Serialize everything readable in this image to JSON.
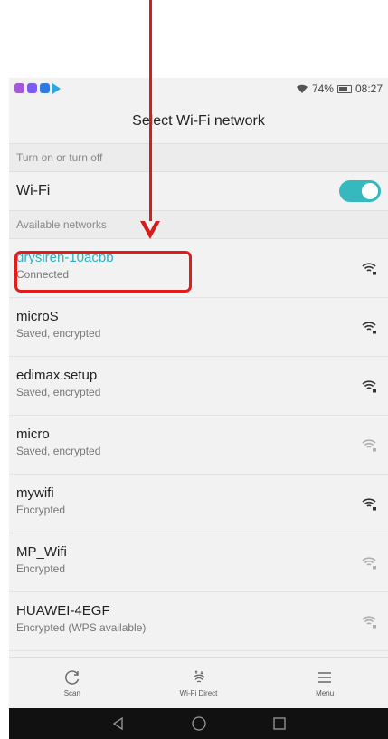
{
  "status_bar": {
    "battery": "74%",
    "time": "08:27",
    "notification_icons": [
      "app-icon-purple",
      "app-icon-violet",
      "app-icon-blue",
      "play-store-icon"
    ]
  },
  "header": {
    "title": "Select Wi-Fi network"
  },
  "sections": {
    "toggle_label": "Turn on or turn off",
    "networks_label": "Available networks"
  },
  "wifi_toggle": {
    "label": "Wi-Fi",
    "state": "on"
  },
  "networks": [
    {
      "name": "drysiren-10acbb",
      "status": "Connected",
      "connected": true,
      "signal": "strong"
    },
    {
      "name": "microS",
      "status": "Saved, encrypted",
      "connected": false,
      "signal": "strong"
    },
    {
      "name": "edimax.setup",
      "status": "Saved, encrypted",
      "connected": false,
      "signal": "strong"
    },
    {
      "name": "micro",
      "status": "Saved, encrypted",
      "connected": false,
      "signal": "weak"
    },
    {
      "name": "mywifi",
      "status": "Encrypted",
      "connected": false,
      "signal": "strong"
    },
    {
      "name": "MP_Wifi",
      "status": "Encrypted",
      "connected": false,
      "signal": "weak"
    },
    {
      "name": "HUAWEI-4EGF",
      "status": "Encrypted (WPS available)",
      "connected": false,
      "signal": "weak"
    }
  ],
  "bottom_bar": {
    "scan": "Scan",
    "wifi_direct": "Wi-Fi Direct",
    "menu": "Menu"
  },
  "colors": {
    "accent": "#2fb1c2",
    "toggle_on": "#36b8bf",
    "annotation_red": "#d71c1c"
  }
}
